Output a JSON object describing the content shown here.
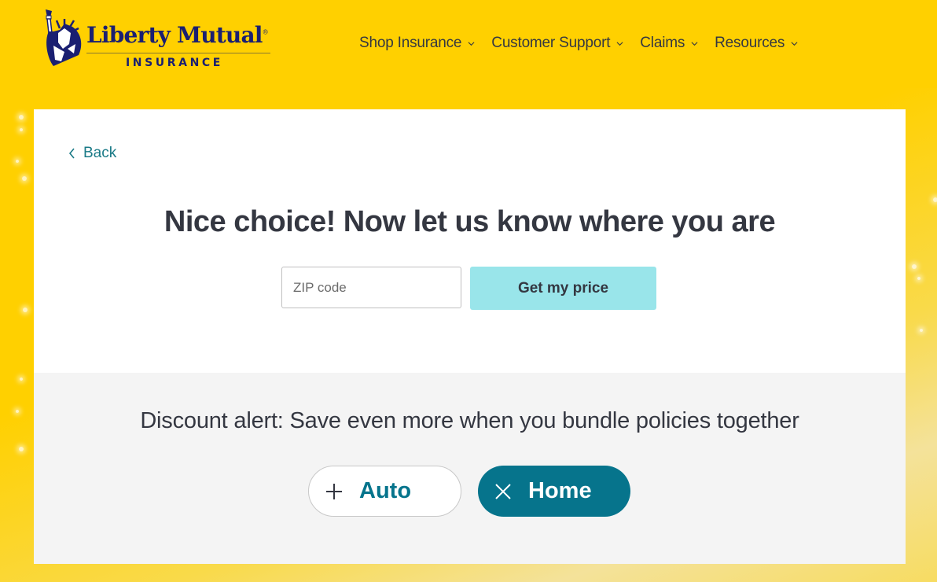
{
  "brand": {
    "name": "Liberty Mutual",
    "reg_mark": "®",
    "subtitle": "INSURANCE",
    "color_navy": "#1a1f71",
    "color_yellow": "#ffd000"
  },
  "nav": {
    "items": [
      {
        "label": "Shop Insurance"
      },
      {
        "label": "Customer Support"
      },
      {
        "label": "Claims"
      },
      {
        "label": "Resources"
      }
    ]
  },
  "page": {
    "back_label": "Back",
    "headline": "Nice choice! Now let us know where you are",
    "zip_field": {
      "value": "",
      "placeholder": "ZIP code"
    },
    "cta_label": "Get my price",
    "cta_color": "#99e5ea"
  },
  "bundle": {
    "alert_text": "Discount alert: Save even more when you bundle policies together",
    "options": [
      {
        "label": "Auto",
        "icon": "plus-icon",
        "selected": false
      },
      {
        "label": "Home",
        "icon": "close-icon",
        "selected": true
      }
    ],
    "accent_color": "#06748c"
  }
}
